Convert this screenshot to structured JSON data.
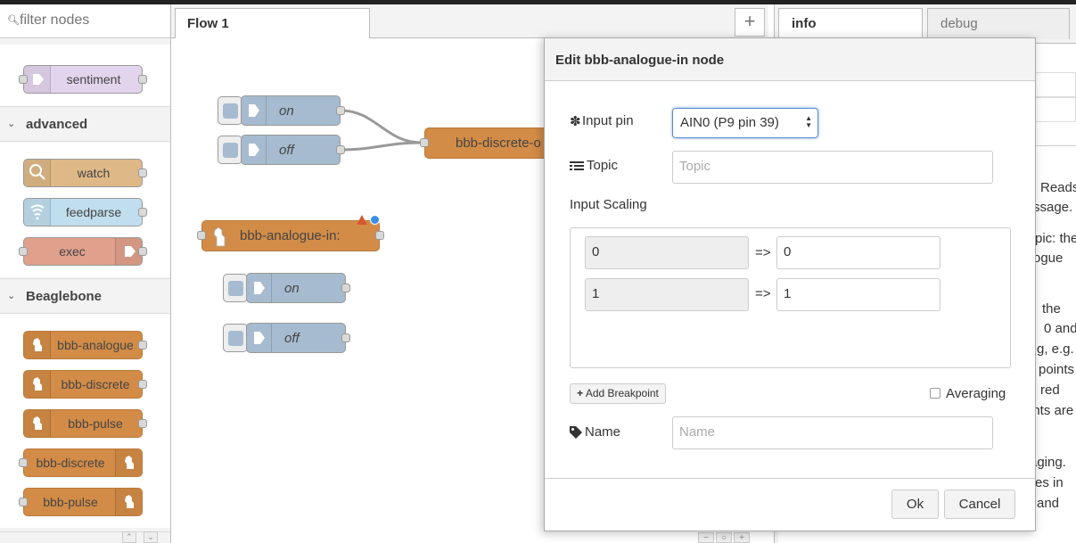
{
  "palette": {
    "filter_placeholder": "filter nodes",
    "nodes_top": [
      {
        "label": "sentiment"
      }
    ],
    "categories": [
      {
        "label": "advanced",
        "nodes": [
          "watch",
          "feedparse",
          "exec"
        ]
      },
      {
        "label": "Beaglebone",
        "nodes": [
          "bbb-analogue",
          "bbb-discrete",
          "bbb-pulse",
          "bbb-discrete",
          "bbb-pulse"
        ]
      }
    ]
  },
  "workspace": {
    "tab_label": "Flow 1",
    "add_tab": "+",
    "nodes": {
      "inject_on_1": "on",
      "inject_off_1": "off",
      "discrete_out": "bbb-discrete-o",
      "analogue_in": "bbb-analogue-in:",
      "inject_on_2": "on",
      "inject_off_2": "off"
    },
    "zoom_controls": [
      "−",
      "○",
      "+"
    ]
  },
  "sidebar": {
    "tabs": [
      "info",
      "debug"
    ],
    "text_fragments": [
      "Reads",
      "ssage.",
      "pic: the",
      "ogue",
      "the",
      "0 and",
      "g, e.g.",
      "points",
      "red",
      "ints are",
      "aging.",
      "es in",
      "and"
    ]
  },
  "dialog": {
    "title": "Edit bbb-analogue-in node",
    "input_pin_label": "Input pin",
    "input_pin_value": "AIN0 (P9 pin 39)",
    "topic_label": "Topic",
    "topic_placeholder": "Topic",
    "input_scaling_label": "Input Scaling",
    "scaling_rows": [
      {
        "from": "0",
        "arrow": "=>",
        "to": "0"
      },
      {
        "from": "1",
        "arrow": "=>",
        "to": "1"
      }
    ],
    "add_breakpoint_label": "Add Breakpoint",
    "averaging_label": "Averaging",
    "averaging_checked": false,
    "name_label": "Name",
    "name_placeholder": "Name",
    "ok_label": "Ok",
    "cancel_label": "Cancel"
  },
  "colors": {
    "function_orange": "#d38c47",
    "inject_blue": "#a6bbcf",
    "sentiment": "#e2d4ec",
    "watch": "#deb887",
    "feedparse": "#c0deed",
    "exec": "#e0a08c"
  }
}
